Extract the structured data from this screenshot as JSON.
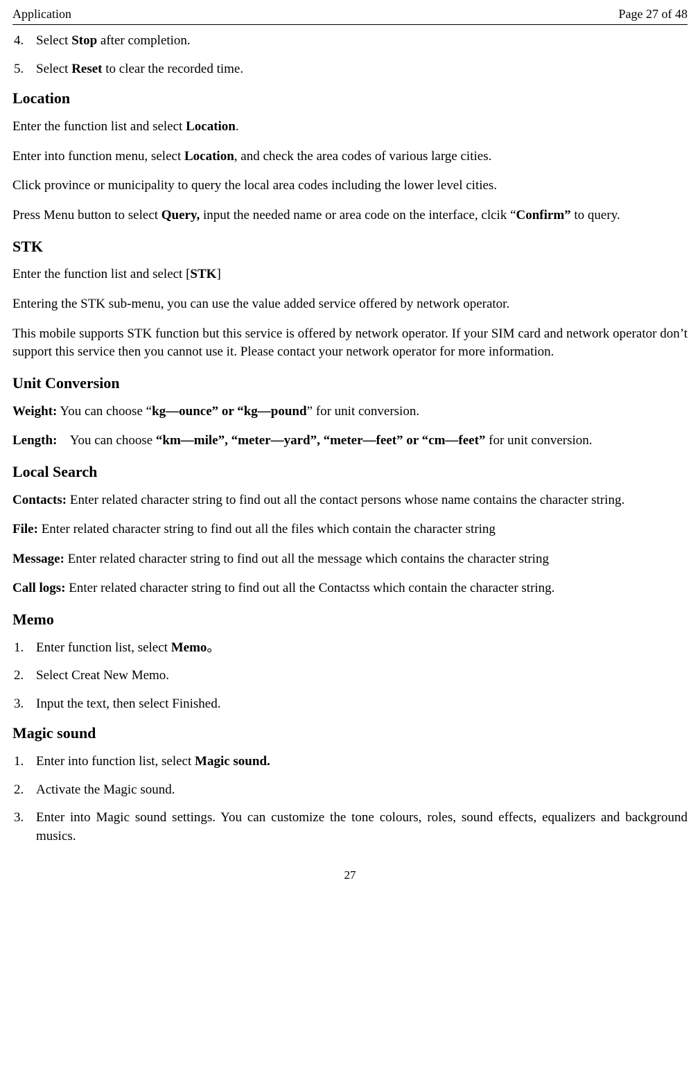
{
  "header": {
    "title": "Application",
    "page_info": "Page 27 of 48"
  },
  "step4": {
    "num": "4.",
    "pre": "Select ",
    "bold": "Stop",
    "post": " after completion."
  },
  "step5": {
    "num": "5.",
    "pre": "Select ",
    "bold": "Reset",
    "post": " to clear the recorded time."
  },
  "location": {
    "heading": "Location",
    "p1_pre": "Enter the function list and select ",
    "p1_bold": "Location",
    "p1_post": ".",
    "p2_pre": "Enter into function menu, select ",
    "p2_bold": "Location",
    "p2_post": ", and check the area codes of various large cities.",
    "p3": "Click province or municipality to query the local area codes including the lower level cities.",
    "p4_a": "Press Menu button to select ",
    "p4_b": "Query,",
    "p4_c": " input the needed name or area code on the interface, clcik “",
    "p4_d": "Confirm”",
    "p4_e": " to query."
  },
  "stk": {
    "heading": "STK",
    "p1_pre": "Enter the function list and select [",
    "p1_bold": "STK",
    "p1_post": "]",
    "p2": "Entering the STK sub-menu, you can use the value added service offered by network operator.",
    "p3": "This mobile supports STK function but this service is offered by network operator. If your SIM card and network operator don’t support this service then you cannot use it. Please contact your network operator for more information."
  },
  "unit": {
    "heading": "Unit Conversion",
    "w_label": "Weight:",
    "w_a": " You can choose “",
    "w_b": "kg—ounce” or “kg—pound",
    "w_c": "” for unit conversion.",
    "l_label": "Length:",
    "l_a": "    You can choose ",
    "l_b": "“km—mile”, “meter—yard”, “meter—feet” or “cm—feet”",
    "l_c": " for unit conversion."
  },
  "search": {
    "heading": "Local Search",
    "c_label": "Contacts:",
    "c_txt": " Enter related character string to find out all the contact persons whose name contains the character string.",
    "f_label": "File:",
    "f_txt": " Enter related character string to find out all the files which contain the character string",
    "m_label": "Message:",
    "m_txt": " Enter related character string to find out all the message which contains the character string",
    "cl_label": "Call logs:",
    "cl_txt": " Enter related character string to find out all the Contactss which contain the character string."
  },
  "memo": {
    "heading": "Memo",
    "s1_num": "1.",
    "s1_pre": "Enter function list, select ",
    "s1_bold": "Memo",
    "s1_post": "。",
    "s2_num": "2.",
    "s2_txt": "Select Creat New Memo.",
    "s3_num": "3.",
    "s3_txt": "Input the text, then select Finished."
  },
  "magic": {
    "heading": "Magic sound",
    "s1_num": "1.",
    "s1_pre": "Enter into function list, select ",
    "s1_bold": "Magic sound.",
    "s2_num": "2.",
    "s2_txt": "Activate the Magic sound.",
    "s3_num": "3.",
    "s3_txt": "Enter into Magic sound settings. You can customize the tone colours, roles, sound effects, equalizers and background musics."
  },
  "footer": {
    "page": "27"
  }
}
